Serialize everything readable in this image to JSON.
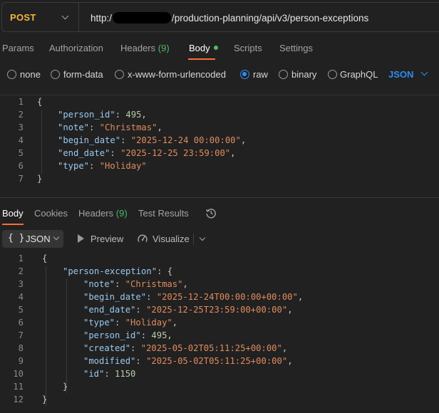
{
  "request": {
    "method": "POST",
    "url_prefix": "http:/",
    "url_suffix": "/production-planning/api/v3/person-exceptions"
  },
  "request_tabs": [
    {
      "label": "Params"
    },
    {
      "label": "Authorization"
    },
    {
      "label": "Headers",
      "count": "(9)"
    },
    {
      "label": "Body",
      "active": true
    },
    {
      "label": "Scripts"
    },
    {
      "label": "Settings"
    }
  ],
  "body_types": [
    {
      "label": "none",
      "selected": false
    },
    {
      "label": "form-data",
      "selected": false
    },
    {
      "label": "x-www-form-urlencoded",
      "selected": false
    },
    {
      "label": "raw",
      "selected": true
    },
    {
      "label": "binary",
      "selected": false
    },
    {
      "label": "GraphQL",
      "selected": false
    }
  ],
  "raw_format": "JSON",
  "request_body": [
    {
      "no": "1",
      "text": "{"
    },
    {
      "no": "2",
      "key": "\"person_id\"",
      "value": "495",
      "vtype": "n",
      "comma": true
    },
    {
      "no": "3",
      "key": "\"note\"",
      "value": "\"Christmas\"",
      "vtype": "s",
      "comma": true
    },
    {
      "no": "4",
      "key": "\"begin_date\"",
      "value": "\"2025-12-24 00:00:00\"",
      "vtype": "s",
      "comma": true
    },
    {
      "no": "5",
      "key": "\"end_date\"",
      "value": "\"2025-12-25 23:59:00\"",
      "vtype": "s",
      "comma": true
    },
    {
      "no": "6",
      "key": "\"type\"",
      "value": "\"Holiday\"",
      "vtype": "s",
      "comma": false
    },
    {
      "no": "7",
      "text": "}"
    }
  ],
  "response_tabs": [
    {
      "label": "Body",
      "active": true
    },
    {
      "label": "Cookies"
    },
    {
      "label": "Headers",
      "count": "(9)"
    },
    {
      "label": "Test Results"
    }
  ],
  "response_toolbar": {
    "format_icon": "{ }",
    "format_label": "JSON",
    "preview_label": "Preview",
    "visualize_label": "Visualize"
  },
  "response_body": [
    {
      "no": "1",
      "text": "{",
      "indent": 0
    },
    {
      "no": "2",
      "key": "\"person-exception\"",
      "value": "{",
      "vtype": "p",
      "comma": false,
      "indent": 1
    },
    {
      "no": "3",
      "key": "\"note\"",
      "value": "\"Christmas\"",
      "vtype": "s",
      "comma": true,
      "indent": 2
    },
    {
      "no": "4",
      "key": "\"begin_date\"",
      "value": "\"2025-12-24T00:00:00+00:00\"",
      "vtype": "s",
      "comma": true,
      "indent": 2
    },
    {
      "no": "5",
      "key": "\"end_date\"",
      "value": "\"2025-12-25T23:59:00+00:00\"",
      "vtype": "s",
      "comma": true,
      "indent": 2
    },
    {
      "no": "6",
      "key": "\"type\"",
      "value": "\"Holiday\"",
      "vtype": "s",
      "comma": true,
      "indent": 2
    },
    {
      "no": "7",
      "key": "\"person_id\"",
      "value": "495",
      "vtype": "n",
      "comma": true,
      "indent": 2
    },
    {
      "no": "8",
      "key": "\"created\"",
      "value": "\"2025-05-02T05:11:25+00:00\"",
      "vtype": "s",
      "comma": true,
      "indent": 2
    },
    {
      "no": "9",
      "key": "\"modified\"",
      "value": "\"2025-05-02T05:11:25+00:00\"",
      "vtype": "s",
      "comma": true,
      "indent": 2
    },
    {
      "no": "10",
      "key": "\"id\"",
      "value": "1150",
      "vtype": "n",
      "comma": false,
      "indent": 2
    },
    {
      "no": "11",
      "text": "}",
      "indent": 1
    },
    {
      "no": "12",
      "text": "}",
      "indent": 0
    }
  ],
  "colors": {
    "method": "#f5b342",
    "accent_tab": "#ff6c37",
    "count_green": "#4fb96c",
    "radio_blue": "#2f8cf0",
    "json_key": "#9ac9ef",
    "json_string": "#e08b5e",
    "json_number": "#b5cea8"
  }
}
